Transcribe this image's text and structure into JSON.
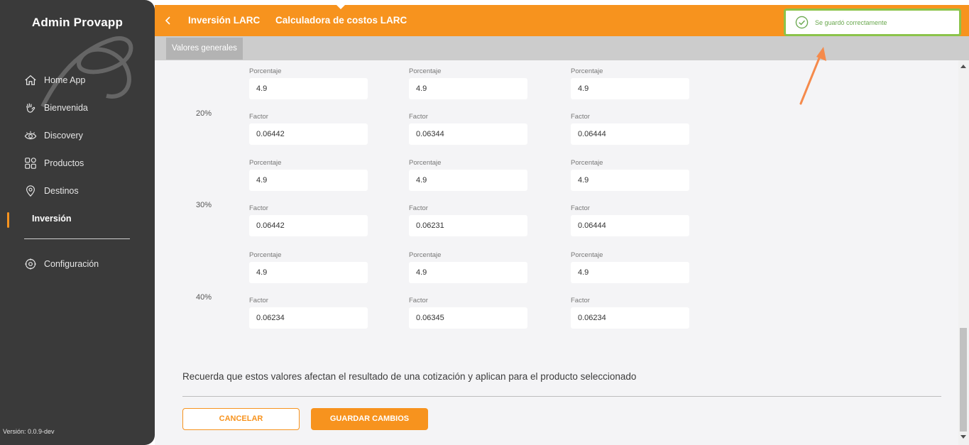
{
  "app": {
    "title": "Admin Provapp",
    "version": "Versión: 0.0.9-dev"
  },
  "sidebar": {
    "items": [
      {
        "label": "Home App",
        "icon": "home-icon"
      },
      {
        "label": "Bienvenida",
        "icon": "waving-hand-icon"
      },
      {
        "label": "Discovery",
        "icon": "eye-icon"
      },
      {
        "label": "Productos",
        "icon": "grid-icon"
      },
      {
        "label": "Destinos",
        "icon": "location-pin-icon"
      },
      {
        "label": "Inversión",
        "icon": "",
        "active": true
      },
      {
        "label": "Configuración",
        "icon": "settings-icon"
      }
    ]
  },
  "header": {
    "breadcrumb": [
      "Inversión LARC",
      "Calculadora de costos LARC"
    ],
    "tabs": [
      "Valores generales"
    ]
  },
  "form": {
    "percentage_label": "Porcentaje",
    "factor_label": "Factor",
    "rows": [
      {
        "label": "20%",
        "porcentaje": [
          "4.9",
          "4.9",
          "4.9"
        ],
        "factor": [
          "0.06442",
          "0.06344",
          "0.06444"
        ]
      },
      {
        "label": "30%",
        "porcentaje": [
          "4.9",
          "4.9",
          "4.9"
        ],
        "factor": [
          "0.06442",
          "0.06231",
          "0.06444"
        ]
      },
      {
        "label": "40%",
        "porcentaje": [
          "4.9",
          "4.9",
          "4.9"
        ],
        "factor": [
          "0.06234",
          "0.06345",
          "0.06234"
        ]
      }
    ]
  },
  "notice": "Recuerda que estos valores afectan el resultado de una cotización y aplican para el producto seleccionado",
  "buttons": {
    "cancel": "CANCELAR",
    "save": "GUARDAR CAMBIOS"
  },
  "toast": {
    "message": "Se guardó correctamente"
  },
  "colors": {
    "accent": "#f7931e",
    "sidebar": "#3a3a3a",
    "success": "#8bc34a"
  }
}
